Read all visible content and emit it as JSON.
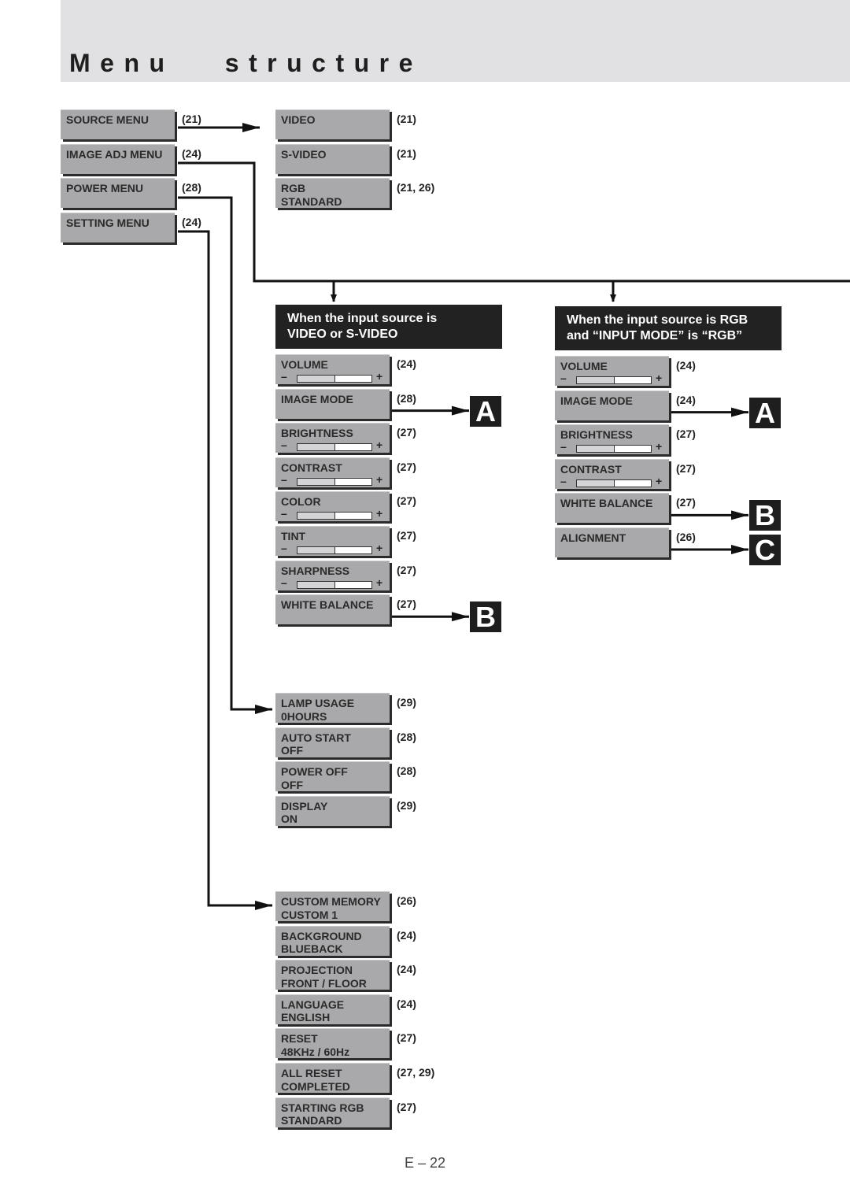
{
  "title": "Menu   structure",
  "top_menu": [
    {
      "label": "SOURCE MENU",
      "ref": "(21)"
    },
    {
      "label": "IMAGE ADJ MENU",
      "ref": "(24)"
    },
    {
      "label": "POWER MENU",
      "ref": "(28)"
    },
    {
      "label": "SETTING MENU",
      "ref": "(24)"
    }
  ],
  "source_menu": [
    {
      "label": "VIDEO",
      "ref": "(21)"
    },
    {
      "label": "S-VIDEO",
      "ref": "(21)"
    },
    {
      "label": "RGB\nSTANDARD",
      "ref": "(21, 26)"
    }
  ],
  "image_adj_video": {
    "header": "When the input source is\nVIDEO or S-VIDEO",
    "items": [
      {
        "label": "VOLUME",
        "ref": "(24)",
        "slider": 0.5
      },
      {
        "label": "IMAGE MODE",
        "ref": "(28)",
        "badge": "A"
      },
      {
        "label": "BRIGHTNESS",
        "ref": "(27)",
        "slider": 0.5
      },
      {
        "label": "CONTRAST",
        "ref": "(27)",
        "slider": 0.5
      },
      {
        "label": "COLOR",
        "ref": "(27)",
        "slider": 0.5
      },
      {
        "label": "TINT",
        "ref": "(27)",
        "slider": 0.5
      },
      {
        "label": "SHARPNESS",
        "ref": "(27)",
        "slider": 0.5
      },
      {
        "label": "WHITE BALANCE",
        "ref": "(27)",
        "badge": "B"
      }
    ]
  },
  "image_adj_rgb": {
    "header": "When the input source is RGB\nand “INPUT MODE” is “RGB”",
    "items": [
      {
        "label": "VOLUME",
        "ref": "(24)",
        "slider": 0.5
      },
      {
        "label": "IMAGE MODE",
        "ref": "(24)",
        "badge": "A"
      },
      {
        "label": "BRIGHTNESS",
        "ref": "(27)",
        "slider": 0.5
      },
      {
        "label": "CONTRAST",
        "ref": "(27)",
        "slider": 0.5
      },
      {
        "label": "WHITE BALANCE",
        "ref": "(27)",
        "badge": "B"
      },
      {
        "label": "ALIGNMENT",
        "ref": "(26)",
        "badge": "C"
      }
    ]
  },
  "power_menu": [
    {
      "label": "LAMP USAGE\n0HOURS",
      "ref": "(29)"
    },
    {
      "label": "AUTO START\nOFF",
      "ref": "(28)"
    },
    {
      "label": "POWER OFF\nOFF",
      "ref": "(28)"
    },
    {
      "label": "DISPLAY\nON",
      "ref": "(29)"
    }
  ],
  "setting_menu": [
    {
      "label": "CUSTOM MEMORY\nCUSTOM 1",
      "ref": "(26)"
    },
    {
      "label": "BACKGROUND\nBLUEBACK",
      "ref": "(24)"
    },
    {
      "label": "PROJECTION\nFRONT / FLOOR",
      "ref": "(24)"
    },
    {
      "label": "LANGUAGE\nENGLISH",
      "ref": "(24)"
    },
    {
      "label": "RESET\n48KHz / 60Hz",
      "ref": "(27)"
    },
    {
      "label": "ALL RESET\nCOMPLETED",
      "ref": "(27, 29)"
    },
    {
      "label": "STARTING RGB\nSTANDARD",
      "ref": "(27)"
    }
  ],
  "page_number": "E – 22",
  "colors": {
    "band": "#e1e1e3",
    "box": "#a9a9ab",
    "header": "#222222",
    "badge": "#1e1e1e"
  }
}
